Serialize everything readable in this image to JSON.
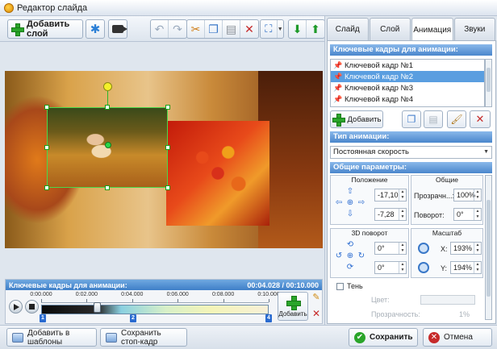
{
  "window": {
    "title": "Редактор слайда"
  },
  "toolbar": {
    "add_layer_label": "Добавить слой",
    "icons": [
      "effects-icon",
      "video-icon",
      "undo-icon",
      "redo-icon",
      "cut-icon",
      "copy-icon",
      "paste-icon",
      "delete-icon",
      "fit-icon",
      "move-down-icon",
      "move-up-icon"
    ]
  },
  "timeline": {
    "title": "Ключевые кадры для анимации:",
    "time": "00:04.028 / 00:10.000",
    "ticks": [
      "0:00.000",
      "0:02.000",
      "0:04.000",
      "0:06.000",
      "0:08.000",
      "0:10.000"
    ],
    "keyframes": [
      "1",
      "2",
      "4"
    ],
    "add_label": "Добавить"
  },
  "bottom": {
    "templates_label": "Добавить в шаблоны",
    "snapshot_label": "Сохранить стоп-кадр",
    "save_label": "Сохранить",
    "cancel_label": "Отмена"
  },
  "tabs": [
    "Слайд",
    "Слой",
    "Анимация",
    "Звуки"
  ],
  "active_tab": "Анимация",
  "panel": {
    "keyframes_title": "Ключевые кадры для анимации:",
    "keyframes": [
      "Ключевой кадр №1",
      "Ключевой кадр №2",
      "Ключевой кадр №3",
      "Ключевой кадр №4"
    ],
    "selected_keyframe": "Ключевой кадр №2",
    "add_label": "Добавить",
    "anim_type_title": "Тип анимации:",
    "anim_type_value": "Постоянная скорость",
    "params_title": "Общие параметры:",
    "position_caption": "Положение",
    "general_caption": "Общие",
    "pos_x": "-17,10",
    "pos_y": "-7,28",
    "opacity_label": "Прозрачн...:",
    "opacity_value": "100%",
    "rotation_label": "Поворот:",
    "rotation_value": "0°",
    "rotation3d_caption": "3D поворот",
    "rot3d_a": "0°",
    "rot3d_b": "0°",
    "scale_caption": "Масштаб",
    "scale_x_label": "X:",
    "scale_x": "193%",
    "scale_y_label": "Y:",
    "scale_y": "194%",
    "shadow_label": "Тень",
    "shadow_color_label": "Цвет:",
    "shadow_opacity_label": "Прозрачность:",
    "shadow_opacity": "1%"
  },
  "colors": {
    "accent": "#4a86cc",
    "selection": "#5a9ee0",
    "handle": "#1aa01a"
  }
}
